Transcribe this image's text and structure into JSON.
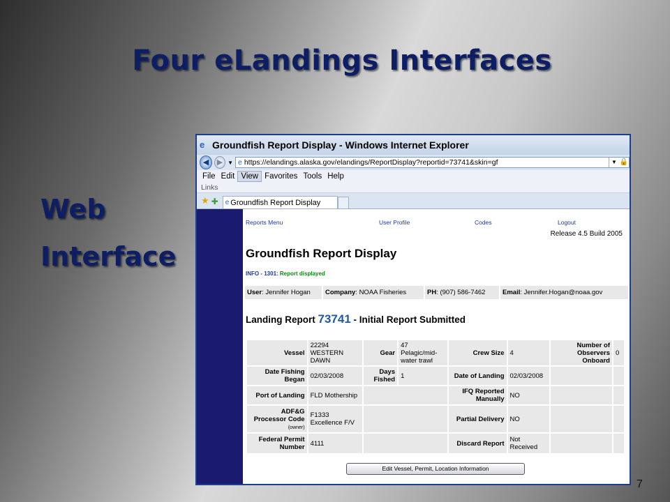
{
  "slide": {
    "title": "Four eLandings Interfaces",
    "label_line1": "Web",
    "label_line2": "Interface",
    "page_number": "7"
  },
  "browser": {
    "window_title": "Groundfish Report Display - Windows Internet Explorer",
    "url": "https://elandings.alaska.gov/elandings/ReportDisplay?reportid=73741&skin=gf",
    "menu": [
      "File",
      "Edit",
      "View",
      "Favorites",
      "Tools",
      "Help"
    ],
    "active_menu": "View",
    "links_label": "Links",
    "tab_title": "Groundfish Report Display"
  },
  "page": {
    "nav": {
      "reports_menu": "Reports Menu",
      "user_profile": "User Profile",
      "codes": "Codes",
      "logout": "Logout"
    },
    "release": "Release 4.5 Build 2005",
    "title": "Groundfish Report Display",
    "info_code": "INFO - 1301",
    "info_msg": ": Report displayed",
    "user": {
      "user_label": "User",
      "user_value": ": Jennifer Hogan",
      "company_label": "Company",
      "company_value": ": NOAA Fisheries",
      "ph_label": "PH",
      "ph_value": ": (907) 586-7462",
      "email_label": "Email",
      "email_value": ": Jennifer.Hogan@noaa.gov"
    },
    "landing_prefix": "Landing Report ",
    "landing_number": "73741",
    "landing_suffix": " - Initial Report Submitted",
    "fields": {
      "vessel_label": "Vessel",
      "vessel_value": "22294 WESTERN DAWN",
      "gear_label": "Gear",
      "gear_value": "47 Pelagic/mid-water trawl",
      "crew_label": "Crew Size",
      "crew_value": "4",
      "observers_label": "Number of Observers Onboard",
      "observers_value": "0",
      "date_began_label": "Date Fishing Began",
      "date_began_value": "02/03/2008",
      "days_label": "Days Fished",
      "days_value": "1",
      "date_landing_label": "Date of Landing",
      "date_landing_value": "02/03/2008",
      "port_label": "Port of Landing",
      "port_value": "FLD Mothership",
      "ifq_label": "IFQ Reported Manually",
      "ifq_value": "NO",
      "processor_label": "ADF&G Processor Code",
      "processor_owner": "(owner)",
      "processor_value": "F1333 Excellence F/V",
      "partial_label": "Partial Delivery",
      "partial_value": "NO",
      "permit_label": "Federal Permit Number",
      "permit_value": "4111",
      "discard_label": "Discard Report",
      "discard_value": "Not Received"
    },
    "edit_button": "Edit Vessel, Permit, Location Information"
  }
}
